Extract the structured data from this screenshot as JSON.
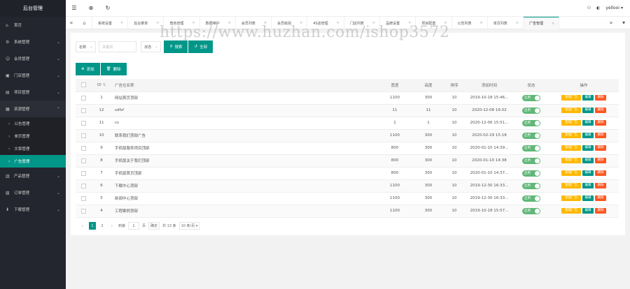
{
  "app": {
    "title": "后台管理"
  },
  "sidebar": {
    "items": [
      {
        "label": "首页",
        "icon": "home-icon",
        "glyph": "⌂",
        "has_caret": false
      },
      {
        "label": "系统管理",
        "icon": "gear-icon",
        "glyph": "⚙",
        "has_caret": true
      },
      {
        "label": "会员管理",
        "icon": "user-icon",
        "glyph": "☺",
        "has_caret": true
      },
      {
        "label": "门店管理",
        "icon": "store-icon",
        "glyph": "▣",
        "has_caret": true
      },
      {
        "label": "项目管理",
        "icon": "project-icon",
        "glyph": "▤",
        "has_caret": true
      },
      {
        "label": "资源管理",
        "icon": "resource-icon",
        "glyph": "▦",
        "has_caret": true
      }
    ],
    "resource_sub": [
      {
        "label": "公告管理",
        "active": false
      },
      {
        "label": "单页管理",
        "active": false
      },
      {
        "label": "文章管理",
        "active": false
      },
      {
        "label": "广告管理",
        "active": true
      }
    ],
    "items_after": [
      {
        "label": "产品管理",
        "icon": "product-icon",
        "glyph": "▥",
        "has_caret": true
      },
      {
        "label": "订单管理",
        "icon": "order-icon",
        "glyph": "▧",
        "has_caret": true
      },
      {
        "label": "下载管理",
        "icon": "download-icon",
        "glyph": "⬇",
        "has_caret": true
      }
    ]
  },
  "header": {
    "menu_icon": "menu-icon",
    "globe_icon": "globe-icon",
    "refresh_icon": "refresh-icon",
    "username": "yellooi"
  },
  "tabs": [
    {
      "label": "系统设置"
    },
    {
      "label": "后台菜单"
    },
    {
      "label": "角色管理"
    },
    {
      "label": "数据维护"
    },
    {
      "label": "会员列表"
    },
    {
      "label": "会员级别"
    },
    {
      "label": "4S店管理"
    },
    {
      "label": "门店列表"
    },
    {
      "label": "品牌设置"
    },
    {
      "label": "项目配置"
    },
    {
      "label": "公告列表"
    },
    {
      "label": "单页列表"
    },
    {
      "label": "广告管理",
      "active": true
    }
  ],
  "filter": {
    "field_select": "名称",
    "keyword_placeholder": "关键词",
    "status_select": "状态",
    "search_label": "搜索",
    "all_label": "全部"
  },
  "actions": {
    "add_label": "添加",
    "delete_label": "删除"
  },
  "table": {
    "headers": {
      "id": "ID",
      "name": "广告位名称",
      "width": "宽度",
      "height": "高度",
      "sort": "排序",
      "time": "添加时间",
      "status": "状态",
      "ops": "操作"
    },
    "rows": [
      {
        "id": "1",
        "name": "网站首页顶部",
        "width": "1100",
        "height": "300",
        "sort": "10",
        "time": "2019-10-18 15:46..."
      },
      {
        "id": "12",
        "name": "sdfsf",
        "width": "11",
        "height": "11",
        "sort": "10",
        "time": "2020-12-08 16:02"
      },
      {
        "id": "11",
        "name": "cs",
        "width": "1",
        "height": "1",
        "sort": "10",
        "time": "2020-12-06 15:51..."
      },
      {
        "id": "10",
        "name": "联系我们顶部广告",
        "width": "1100",
        "height": "300",
        "sort": "10",
        "time": "2020-02-29 15:18"
      },
      {
        "id": "9",
        "name": "手机版服务项目顶部",
        "width": "800",
        "height": "300",
        "sort": "10",
        "time": "2020-01-10 14:39..."
      },
      {
        "id": "8",
        "name": "手机版关于我们顶部",
        "width": "800",
        "height": "300",
        "sort": "10",
        "time": "2020-01-10 14:38"
      },
      {
        "id": "7",
        "name": "手机版首页顶部",
        "width": "800",
        "height": "300",
        "sort": "10",
        "time": "2020-01-10 14:37..."
      },
      {
        "id": "6",
        "name": "下载中心顶部",
        "width": "1100",
        "height": "300",
        "sort": "10",
        "time": "2019-12-30 16:33..."
      },
      {
        "id": "5",
        "name": "新闻中心顶部",
        "width": "1100",
        "height": "300",
        "sort": "10",
        "time": "2019-12-30 16:33..."
      },
      {
        "id": "4",
        "name": "工程案例顶部",
        "width": "1100",
        "height": "300",
        "sort": "10",
        "time": "2019-10-18 15:57..."
      }
    ],
    "status_label": "启用",
    "op_manage": "管理广告",
    "op_edit": "编辑",
    "op_delete": "删除"
  },
  "pagination": {
    "prev": "‹",
    "pages": [
      "1",
      "2"
    ],
    "next": "›",
    "goto_label": "到第",
    "goto_value": "1",
    "page_unit": "页",
    "confirm": "确定",
    "total": "共 13 条",
    "per_page": "10 条/页"
  },
  "watermark": "https://www.huzhan.com/ishop3572",
  "colors": {
    "primary": "#009688",
    "warn": "#ffb800",
    "danger": "#ff5722",
    "switch_on": "#5fb878",
    "sidebar": "#23262e"
  }
}
